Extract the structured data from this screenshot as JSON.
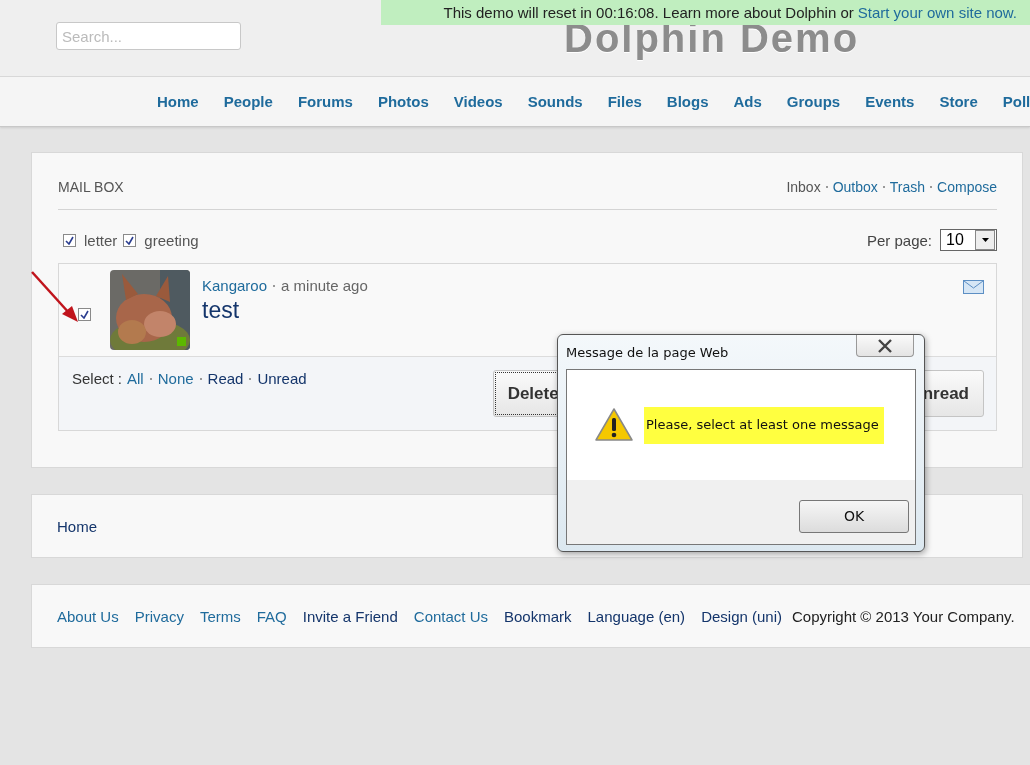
{
  "header": {
    "search": {
      "placeholder": "Search..."
    },
    "logo": "Dolphin Demo",
    "banner": {
      "text": "This demo will reset in 00:16:08. Learn more about Dolphin or",
      "link": "Start your own site now."
    }
  },
  "nav": [
    "Home",
    "People",
    "Forums",
    "Photos",
    "Videos",
    "Sounds",
    "Files",
    "Blogs",
    "Ads",
    "Groups",
    "Events",
    "Store",
    "Poll"
  ],
  "mailbox": {
    "title": "MAIL BOX",
    "folders": [
      {
        "label": "Inbox",
        "selected": true
      },
      {
        "label": "Outbox",
        "selected": false
      },
      {
        "label": "Trash",
        "selected": false
      },
      {
        "label": "Compose",
        "selected": false
      }
    ],
    "filters": [
      {
        "label": "letter",
        "checked": true
      },
      {
        "label": "greeting",
        "checked": true
      }
    ],
    "per_page": {
      "label": "Per page:",
      "value": "10"
    },
    "messages": [
      {
        "checked": true,
        "online": true,
        "sender": "Kangaroo",
        "time": "a minute ago",
        "subject": "test"
      }
    ],
    "select": {
      "label": "Select :",
      "options": [
        {
          "label": "All",
          "kind": "link"
        },
        {
          "label": "None",
          "kind": "link"
        },
        {
          "label": "Read",
          "kind": "action"
        },
        {
          "label": "Unread",
          "kind": "action"
        }
      ]
    },
    "buttons": [
      "Delete",
      "nread"
    ]
  },
  "breadcrumb": [
    "Home"
  ],
  "footer": [
    {
      "label": "About Us",
      "kind": "link"
    },
    {
      "label": "Privacy",
      "kind": "link"
    },
    {
      "label": "Terms",
      "kind": "link"
    },
    {
      "label": "FAQ",
      "kind": "link"
    },
    {
      "label": "Invite a Friend",
      "kind": "action"
    },
    {
      "label": "Contact Us",
      "kind": "link"
    },
    {
      "label": "Bookmark",
      "kind": "action"
    },
    {
      "label": "Language (en)",
      "kind": "action"
    },
    {
      "label": "Design (uni)",
      "kind": "action"
    },
    {
      "label": "Copyright © 2013 Your Company.",
      "kind": "text"
    }
  ],
  "dialog": {
    "title": "Message de la page Web",
    "message": "Please, select at least one message",
    "button": "OK"
  }
}
